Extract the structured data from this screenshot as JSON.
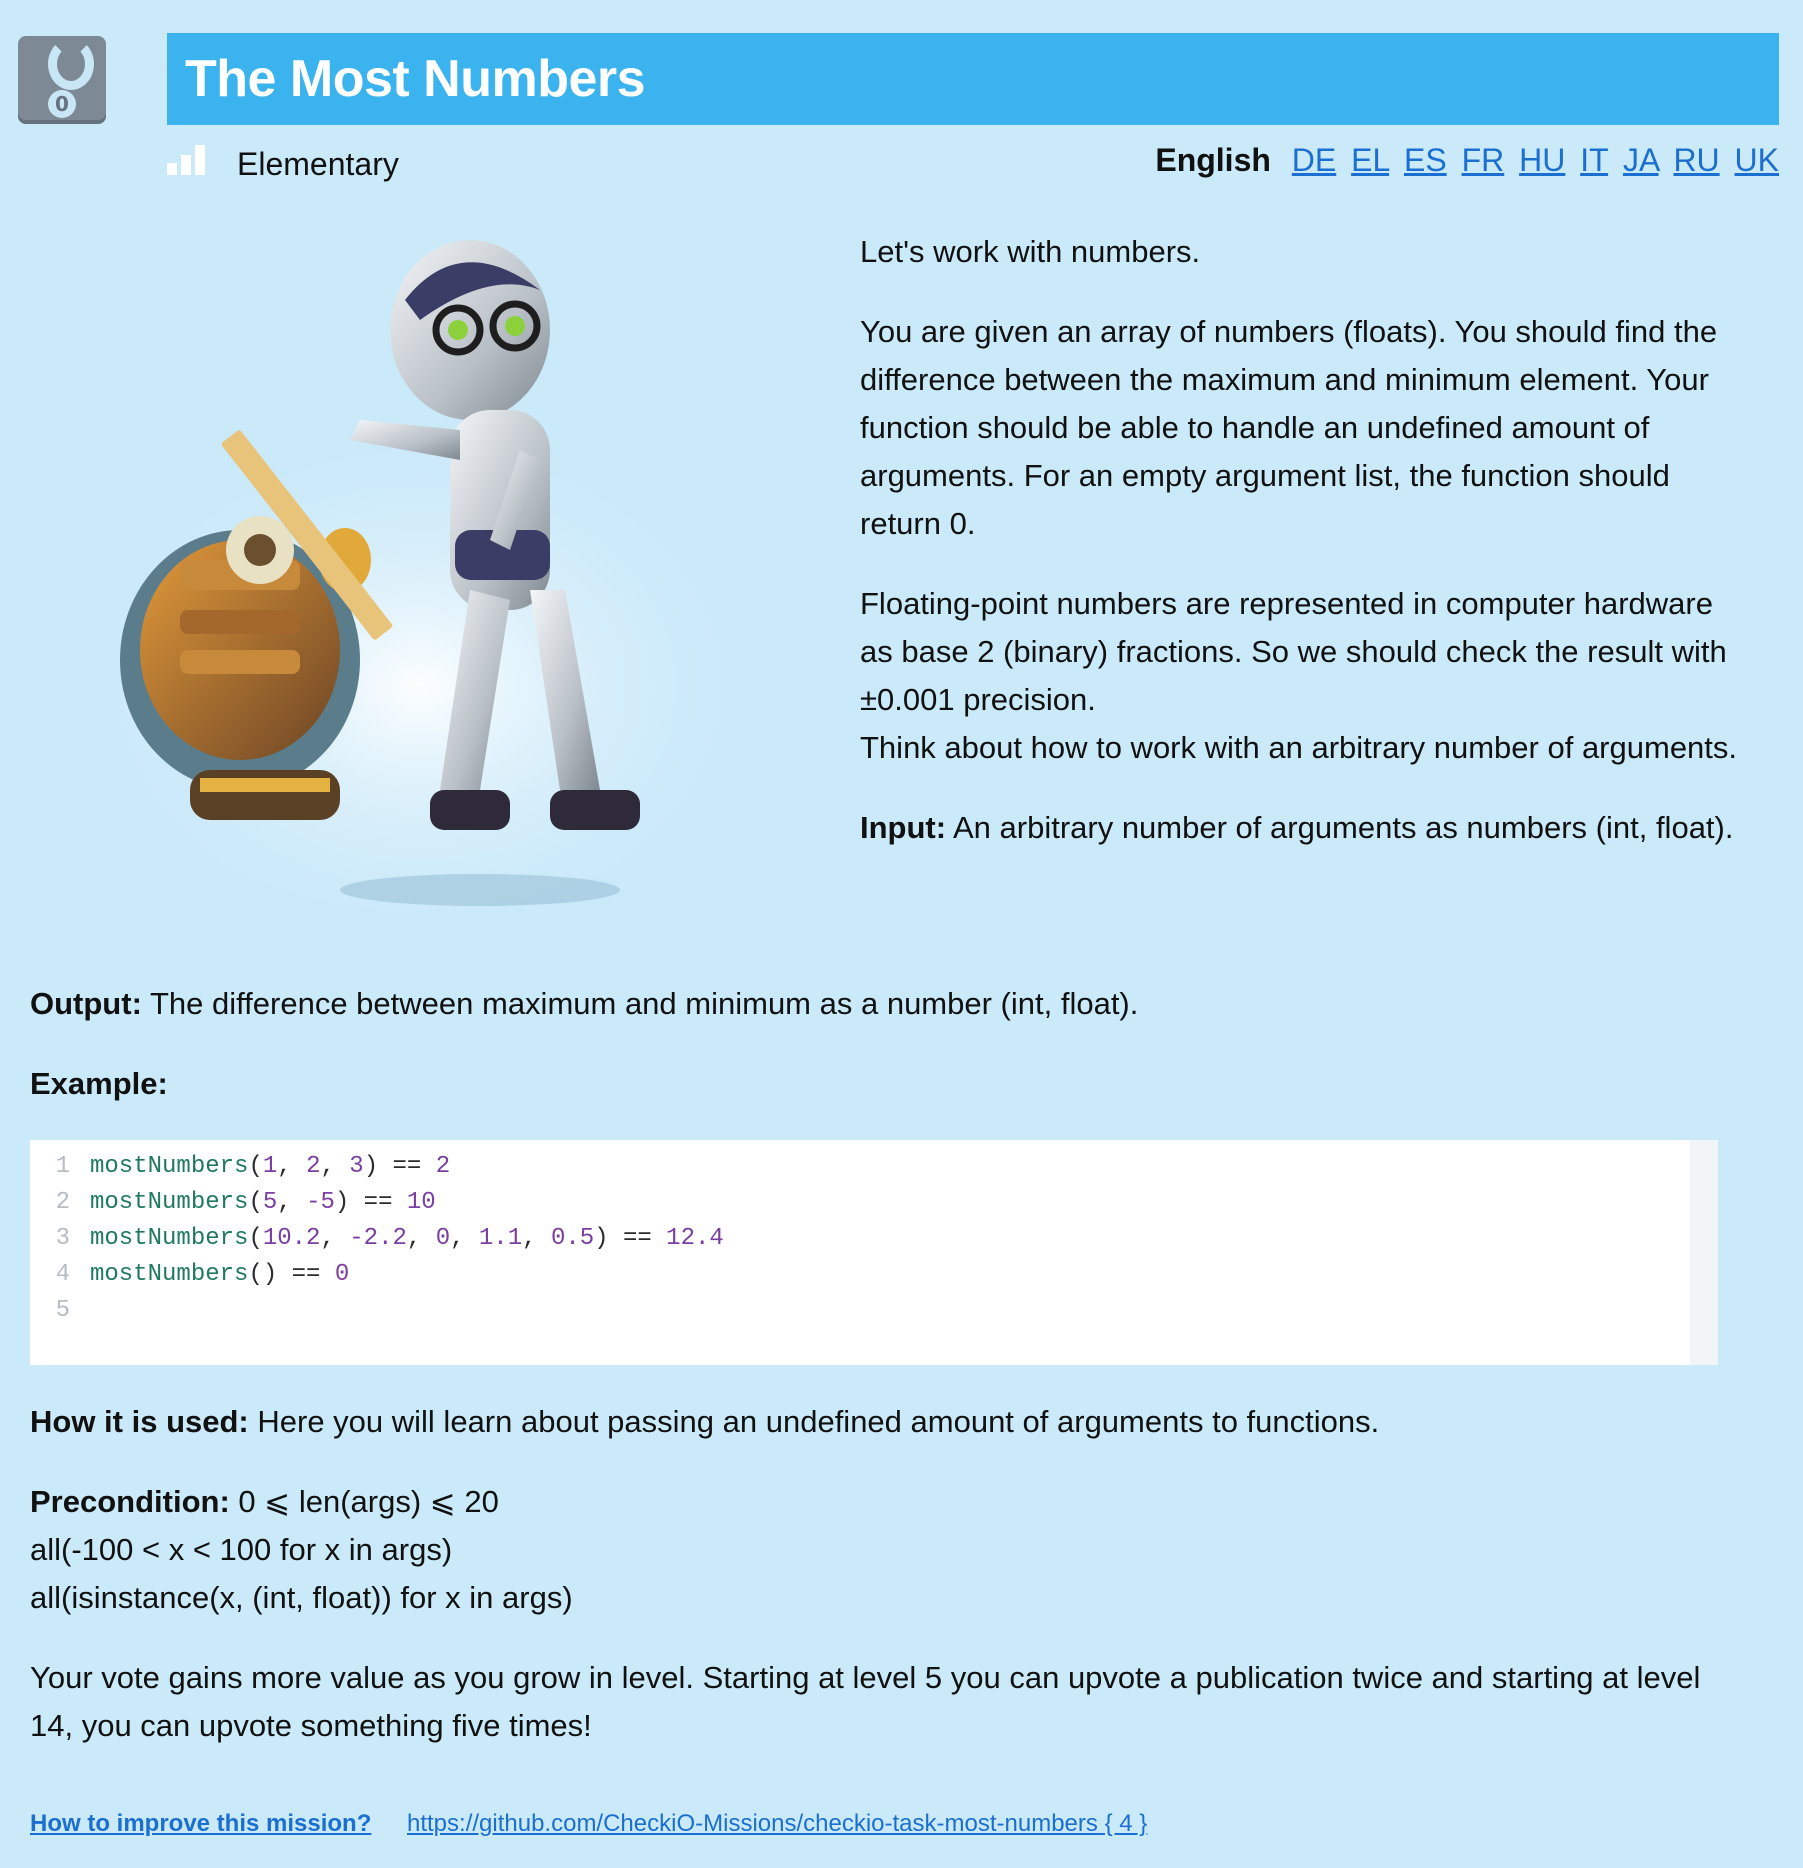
{
  "header": {
    "title": "The Most Numbers",
    "difficulty": "Elementary",
    "current_language": "English",
    "languages": [
      "DE",
      "EL",
      "ES",
      "FR",
      "HU",
      "IT",
      "JA",
      "RU",
      "UK"
    ]
  },
  "content": {
    "p1": "Let's work with numbers.",
    "p2": "You are given an array of numbers (floats). You should find the difference between the maximum and minimum element. Your function should be able to handle an undefined amount of arguments. For an empty argument list, the function should return 0.",
    "p3a": "Floating-point numbers are represented in computer hardware as base 2 (binary) fractions. So we should check the result with ±0.001 precision.",
    "p3b": "Think about how to work with an arbitrary number of arguments.",
    "input_label": "Input:",
    "input_text": "An arbitrary number of arguments as numbers (int, float).",
    "output_label": "Output:",
    "output_text": "The difference between maximum and minimum as a number (int, float).",
    "example_label": "Example:",
    "how_label": "How it is used:",
    "how_text": "Here you will learn about passing an undefined amount of arguments to functions.",
    "precondition_label": "Precondition:",
    "precondition_1": "0 ⩽ len(args) ⩽ 20",
    "precondition_2": "all(-100 < x < 100 for x in args)",
    "precondition_3": "all(isinstance(x, (int, float)) for x in args)",
    "vote_text": "Your vote gains more value as you grow in level. Starting at level 5 you can upvote a publication twice and starting at level 14, you can upvote something five times!"
  },
  "code": {
    "line_numbers": [
      "1",
      "2",
      "3",
      "4",
      "5"
    ],
    "fn": "mostNumbers",
    "line1": {
      "args": [
        "1",
        "2",
        "3"
      ],
      "result": "2"
    },
    "line2": {
      "args": [
        "5",
        "-5"
      ],
      "result": "10"
    },
    "line3": {
      "args": [
        "10.2",
        "-2.2",
        "0",
        "1.1",
        "0.5"
      ],
      "result": "12.4"
    },
    "line4": {
      "args": [],
      "result": "0"
    }
  },
  "footer": {
    "improve_link": "How to improve this mission?",
    "repo_link": "https://github.com/CheckiO-Missions/checkio-task-most-numbers",
    "repo_count": "{ 4 }"
  },
  "colors": {
    "background": "#cae9f9",
    "title_bar": "#3bb3ee",
    "link": "#1b6fd0",
    "code_function": "#1f7a60",
    "code_number": "#7a3fa0"
  }
}
